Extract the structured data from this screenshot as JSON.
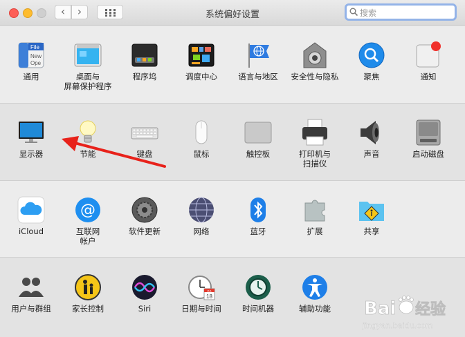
{
  "window": {
    "title": "系统偏好设置"
  },
  "toolbar": {
    "back": "‹",
    "forward": "›"
  },
  "search": {
    "placeholder": "搜索"
  },
  "rows": [
    [
      {
        "label": "通用",
        "icon": "general-icon",
        "file_text": "File",
        "new_text": "New",
        "ope_text": "Ope"
      },
      {
        "label": "桌面与\n屏幕保护程序",
        "icon": "desktop-screensaver-icon"
      },
      {
        "label": "程序坞",
        "icon": "dock-icon"
      },
      {
        "label": "调度中心",
        "icon": "mission-control-icon"
      },
      {
        "label": "语言与地区",
        "icon": "language-region-icon"
      },
      {
        "label": "安全性与隐私",
        "icon": "security-privacy-icon"
      },
      {
        "label": "聚焦",
        "icon": "spotlight-icon"
      },
      {
        "label": "通知",
        "icon": "notifications-icon"
      }
    ],
    [
      {
        "label": "显示器",
        "icon": "displays-icon"
      },
      {
        "label": "节能",
        "icon": "energy-saver-icon"
      },
      {
        "label": "键盘",
        "icon": "keyboard-icon"
      },
      {
        "label": "鼠标",
        "icon": "mouse-icon"
      },
      {
        "label": "触控板",
        "icon": "trackpad-icon"
      },
      {
        "label": "打印机与\n扫描仪",
        "icon": "printers-scanners-icon"
      },
      {
        "label": "声音",
        "icon": "sound-icon"
      },
      {
        "label": "启动磁盘",
        "icon": "startup-disk-icon"
      }
    ],
    [
      {
        "label": "iCloud",
        "icon": "icloud-icon"
      },
      {
        "label": "互联网\n帐户",
        "icon": "internet-accounts-icon"
      },
      {
        "label": "软件更新",
        "icon": "software-update-icon"
      },
      {
        "label": "网络",
        "icon": "network-icon"
      },
      {
        "label": "蓝牙",
        "icon": "bluetooth-icon"
      },
      {
        "label": "扩展",
        "icon": "extensions-icon"
      },
      {
        "label": "共享",
        "icon": "sharing-icon"
      }
    ],
    [
      {
        "label": "用户与群组",
        "icon": "users-groups-icon"
      },
      {
        "label": "家长控制",
        "icon": "parental-controls-icon"
      },
      {
        "label": "Siri",
        "icon": "siri-icon"
      },
      {
        "label": "日期与时间",
        "icon": "date-time-icon",
        "cal_month": "JUL",
        "cal_day": "18"
      },
      {
        "label": "时间机器",
        "icon": "time-machine-icon"
      },
      {
        "label": "辅助功能",
        "icon": "accessibility-icon"
      }
    ]
  ],
  "watermark": {
    "brand": "Bai",
    "brand2": "经验",
    "url": "jingyan.baidu.com"
  },
  "colors": {
    "arrow": "#e8221b",
    "search_focus": "#93b3e8"
  }
}
